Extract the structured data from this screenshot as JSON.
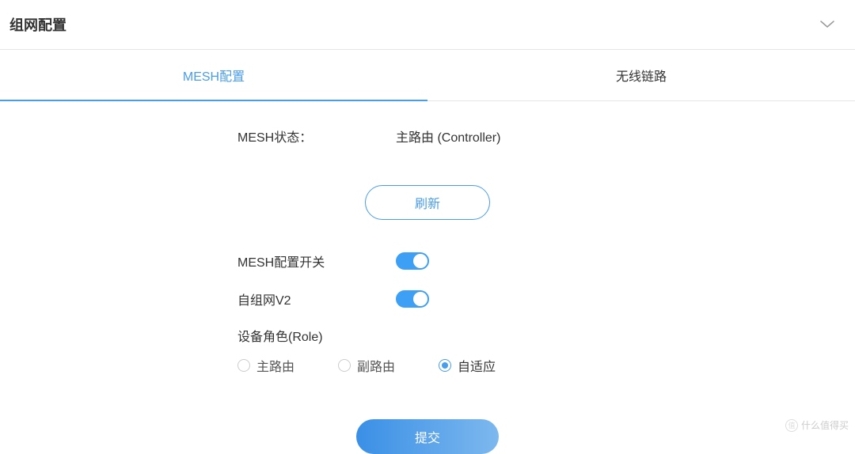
{
  "header": {
    "title": "组网配置"
  },
  "tabs": {
    "items": [
      {
        "label": "MESH配置",
        "active": true
      },
      {
        "label": "无线链路",
        "active": false
      }
    ]
  },
  "status": {
    "label": "MESH状态：",
    "value": "主路由 (Controller)"
  },
  "buttons": {
    "refresh": "刷新",
    "submit": "提交"
  },
  "switches": {
    "mesh_config": {
      "label": "MESH配置开关",
      "on": true
    },
    "auto_net_v2": {
      "label": "自组网V2",
      "on": true
    }
  },
  "role": {
    "title": "设备角色(Role)",
    "options": [
      {
        "label": "主路由",
        "checked": false
      },
      {
        "label": "副路由",
        "checked": false
      },
      {
        "label": "自适应",
        "checked": true
      }
    ]
  },
  "watermark": {
    "icon": "值",
    "text": "什么值得买"
  }
}
